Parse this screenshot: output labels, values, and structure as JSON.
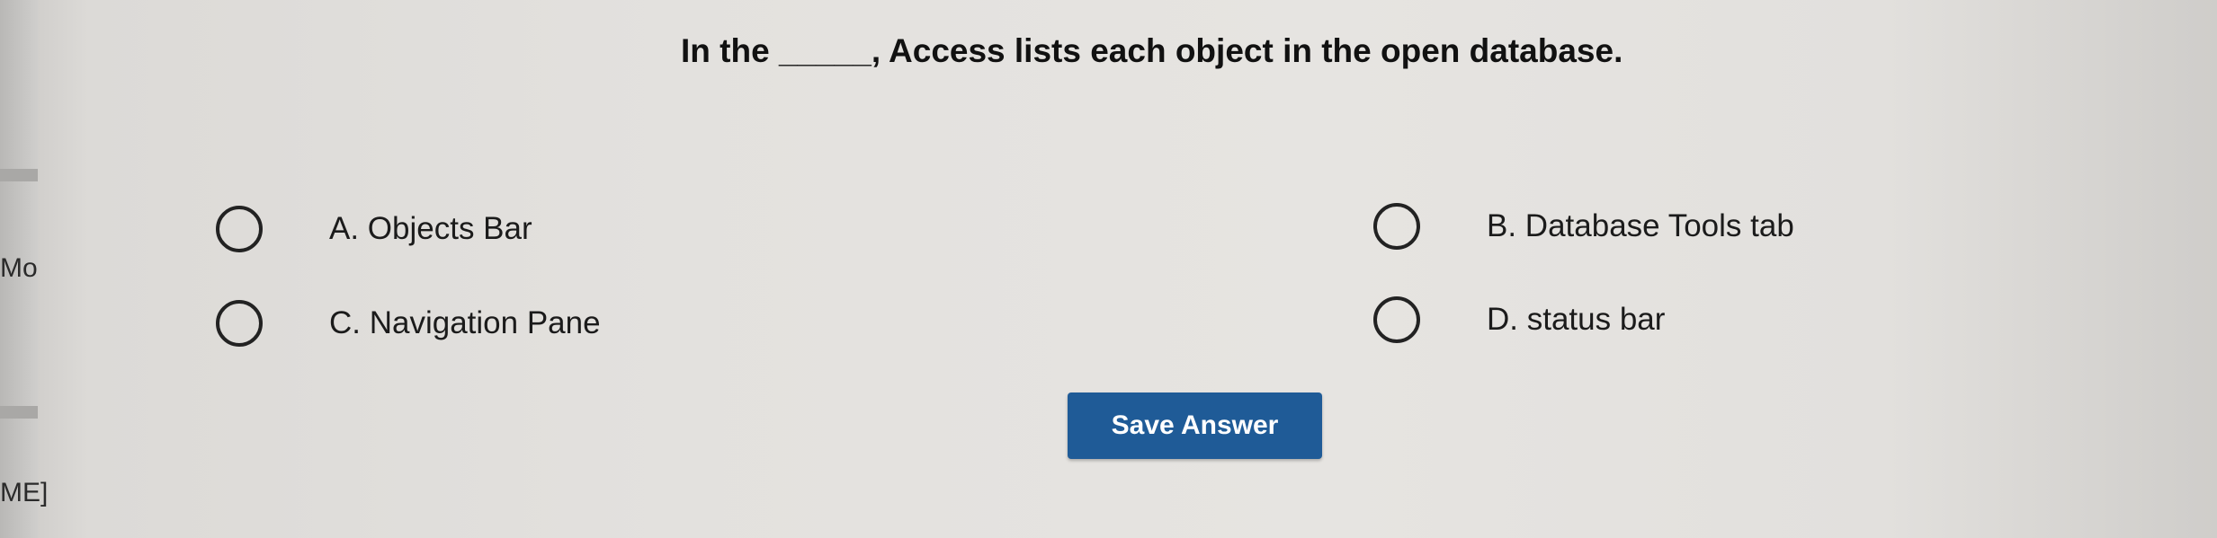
{
  "question": {
    "text": "In the _____, Access lists each object in the open database."
  },
  "options": [
    {
      "label": "A. Objects Bar"
    },
    {
      "label": "B. Database Tools tab"
    },
    {
      "label": "C. Navigation Pane"
    },
    {
      "label": "D. status bar"
    }
  ],
  "save_button": {
    "label": "Save Answer"
  },
  "edge_fragments": {
    "top": "Mo",
    "bottom": "ME]"
  },
  "colors": {
    "button": "#1f5b97",
    "background": "#e3e1de"
  }
}
